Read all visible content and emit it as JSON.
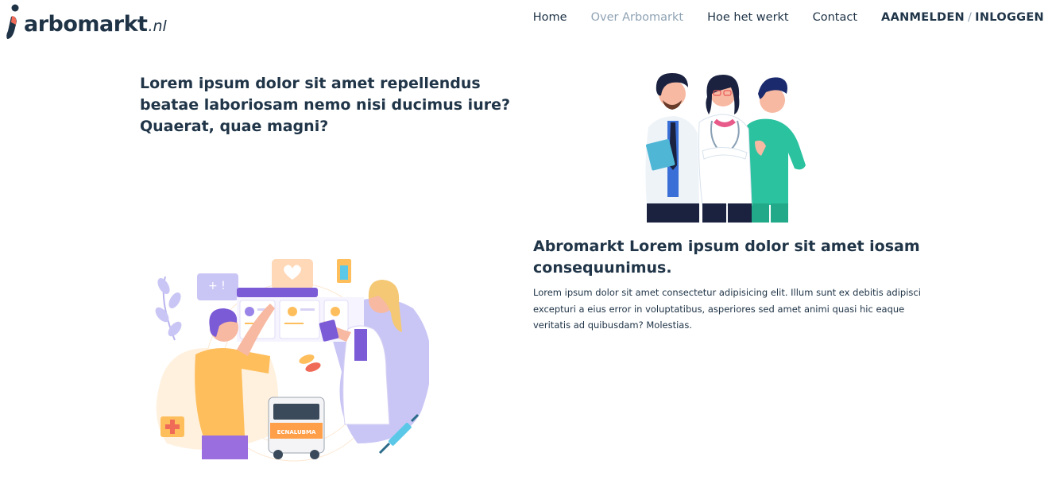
{
  "brand": {
    "name": "arbomarkt",
    "tld": ".nl"
  },
  "nav": {
    "home": "Home",
    "about": "Over Arbomarkt",
    "how": "Hoe het werkt",
    "contact": "Contact",
    "register": "AANMELDEN",
    "separator": "/",
    "login": "INLOGGEN"
  },
  "hero": {
    "headline": "Lorem ipsum dolor sit amet repellendus beatae laboriosam nemo nisi ducimus iure? Quaerat, quae magni?"
  },
  "section": {
    "title": "Abromarkt Lorem ipsum dolor sit amet iosam consequunimus.",
    "body": "Lorem ipsum dolor sit amet consectetur adipisicing elit. Illum sunt ex debitis adipisci excepturi a eius error in voluptatibus, asperiores sed amet animi quasi hic eaque veritatis ad quibusdam? Molestias."
  },
  "ambulance": {
    "label": "ECNALUBMA"
  },
  "colors": {
    "text": "#203548",
    "muted": "#8fa3b4",
    "accent_purple": "#7b5bd6",
    "accent_orange": "#ffbe5c",
    "accent_teal": "#2bc2a0"
  }
}
